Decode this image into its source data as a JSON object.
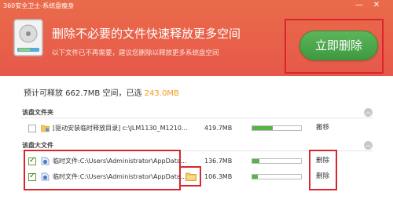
{
  "window": {
    "title": "360安全卫士-系统盘瘦身",
    "minimize_glyph": "—",
    "close_glyph": "✕"
  },
  "header": {
    "headline": "删除不必要的文件快速释放更多空间",
    "subline": "以下文件已不再需要，建议您删除以释放更多系统盘空间",
    "delete_button": "立即删除",
    "icon": "hard-drive-icon"
  },
  "summary": {
    "prefix": "预计可释放 662.7MB 空间，已选",
    "selected": "243.0MB",
    "accent_color": "#f39a1e"
  },
  "sections": [
    {
      "title": "该盘文件夹",
      "collapse_glyph": "︿",
      "rows": [
        {
          "checked": false,
          "icon": "folder-lock-icon",
          "text": "[驱动安装临时释放目录] c:\\JLM1130_M1210...",
          "size": "419.7MB",
          "progress": 0.42,
          "action": "搬移"
        }
      ]
    },
    {
      "title": "该盘大文件",
      "collapse_glyph": "︿",
      "rows": [
        {
          "checked": true,
          "icon": "file-shield-icon",
          "text": "临时文件:C:\\Users\\Administrator\\AppData...",
          "size": "136.7MB",
          "progress": 0.14,
          "action": "删除"
        },
        {
          "checked": true,
          "icon": "file-shield-icon",
          "text": "临时文件:C:\\Users\\Administrator\\AppData...",
          "size": "106.3MB",
          "progress": 0.11,
          "action": "删除"
        }
      ]
    }
  ],
  "colors": {
    "header": "#e6584a",
    "button_green": "#4aa64a",
    "progress_green": "#58b14a",
    "annotation_red": "#d9262c"
  }
}
